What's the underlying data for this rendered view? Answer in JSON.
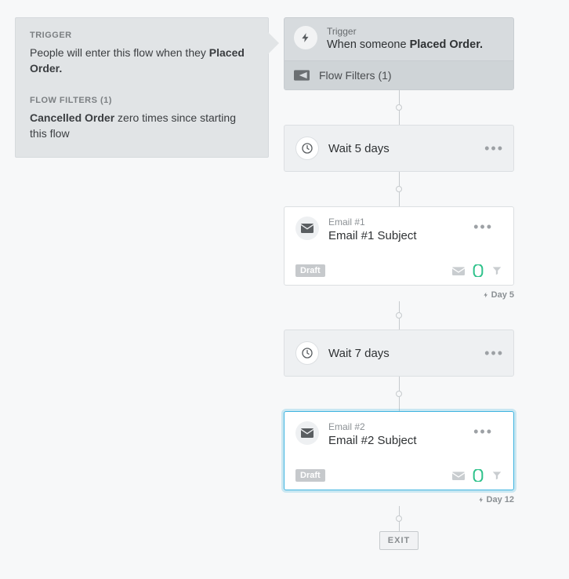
{
  "info_panel": {
    "trigger_label": "TRIGGER",
    "trigger_pre": "People will enter this flow when they ",
    "trigger_bold": "Placed Order.",
    "filters_label": "FLOW FILTERS (1)",
    "filter_bold": "Cancelled Order",
    "filter_rest": " zero times since starting this flow"
  },
  "trigger_card": {
    "eyebrow": "Trigger",
    "line_pre": "When someone ",
    "line_bold": "Placed Order.",
    "filters_label": "Flow Filters (1)"
  },
  "wait1": {
    "text": "Wait 5 days"
  },
  "wait2": {
    "text": "Wait 7 days"
  },
  "email1": {
    "eyebrow": "Email #1",
    "subject": "Email #1 Subject",
    "badge": "Draft",
    "day_label": "Day 5"
  },
  "email2": {
    "eyebrow": "Email #2",
    "subject": "Email #2 Subject",
    "badge": "Draft",
    "day_label": "Day 12"
  },
  "exit_label": "EXIT"
}
